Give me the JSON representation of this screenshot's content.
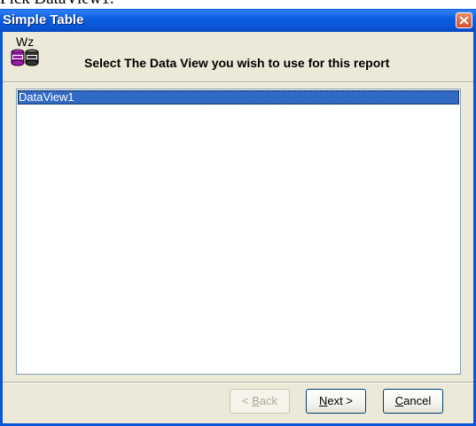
{
  "document": {
    "text_above": "Pick DataView1."
  },
  "window": {
    "title": "Simple Table",
    "logo_text": "Wz",
    "icons": {
      "close": "close-icon",
      "logo": "wizard-database-icon"
    },
    "colors": {
      "titlebar": "#0a54d6",
      "selection": "#316ac5",
      "close": "#d2502a"
    }
  },
  "header": {
    "instruction": "Select The Data View you wish to use for this report"
  },
  "dataview_list": {
    "items": [
      "DataView1"
    ],
    "selected_index": 0
  },
  "buttons": {
    "back": {
      "label": "< Back",
      "enabled": false
    },
    "next": {
      "label": "Next >",
      "enabled": true
    },
    "cancel": {
      "label": "Cancel",
      "enabled": true
    }
  }
}
